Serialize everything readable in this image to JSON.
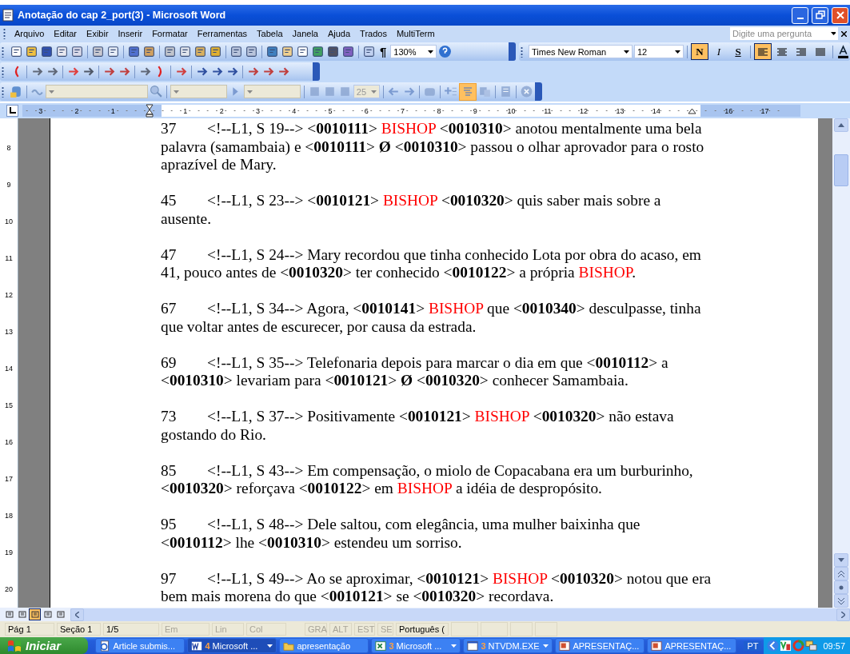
{
  "window": {
    "title": "Anotação do cap 2_port(3) - Microsoft Word"
  },
  "menu": [
    "Arquivo",
    "Editar",
    "Exibir",
    "Inserir",
    "Formatar",
    "Ferramentas",
    "Tabela",
    "Janela",
    "Ajuda",
    "Trados",
    "MultiTerm"
  ],
  "help_box": {
    "placeholder": "Digite uma pergunta"
  },
  "standard_toolbar": {
    "pilcrow": "¶",
    "zoom": "130%"
  },
  "formatting_toolbar": {
    "font": "Times New Roman",
    "size": "12",
    "styles": [
      {
        "label": "N",
        "kind": "bold",
        "selected": true
      },
      {
        "label": "I",
        "kind": "italic",
        "selected": false
      },
      {
        "label": "S",
        "kind": "underline",
        "selected": false
      }
    ],
    "alignments": [
      {
        "kind": "left",
        "selected": true
      },
      {
        "kind": "center",
        "selected": false
      },
      {
        "kind": "right",
        "selected": false
      },
      {
        "kind": "justify",
        "selected": false
      }
    ]
  },
  "trados_toolbar": {
    "number_field": "25",
    "view_on": true
  },
  "ruler": {
    "left_numbers": [
      "3",
      "2",
      "1"
    ],
    "numbers": [
      "1",
      "2",
      "3",
      "4",
      "5",
      "6",
      "7",
      "8",
      "9",
      "10",
      "11",
      "12",
      "13",
      "14"
    ],
    "right_numbers": [
      "16",
      "17"
    ]
  },
  "vertical_ruler": [
    "8",
    "9",
    "10",
    "11",
    "12",
    "13",
    "14",
    "15",
    "16",
    "17",
    "18",
    "19",
    "20"
  ],
  "paragraphs": [
    {
      "number": "37",
      "runs": [
        {
          "kind": "text",
          "text": "<!--L1, S 19--> <**0010111**> "
        },
        {
          "kind": "highlight",
          "text": "BISHOP"
        },
        {
          "kind": "text",
          "text": " <**0010310**> anotou mentalmente uma bela palavra (samambaia) e <**0010111**> **Ø** <**0010310**> passou o olhar aprovador para o rosto aprazível de Mary."
        }
      ]
    },
    {
      "number": "45",
      "runs": [
        {
          "kind": "text",
          "text": "<!--L1, S 23--> <**0010121**> "
        },
        {
          "kind": "highlight",
          "text": "BISHOP"
        },
        {
          "kind": "text",
          "text": " <**0010320**> quis saber mais sobre a ausente."
        }
      ]
    },
    {
      "number": "47",
      "runs": [
        {
          "kind": "text",
          "text": "<!--L1, S 24--> Mary recordou que tinha conhecido Lota por obra do acaso, em 41, pouco antes de <**0010320**> ter conhecido <**0010122**> a própria "
        },
        {
          "kind": "highlight",
          "text": "BISHOP"
        },
        {
          "kind": "text",
          "text": "."
        }
      ]
    },
    {
      "number": "67",
      "runs": [
        {
          "kind": "text",
          "text": "<!--L1, S 34--> Agora, <**0010141**> "
        },
        {
          "kind": "highlight",
          "text": "BISHOP"
        },
        {
          "kind": "text",
          "text": " que <**0010340**> desculpasse, tinha que voltar antes de escurecer, por causa da estrada."
        }
      ]
    },
    {
      "number": "69",
      "runs": [
        {
          "kind": "text",
          "text": "<!--L1, S 35--> Telefonaria depois para marcar o dia em que <**0010112**> a <**0010310**> levariam para <**0010121**> **Ø** <**0010320**> conhecer Samambaia."
        }
      ]
    },
    {
      "number": "73",
      "runs": [
        {
          "kind": "text",
          "text": "<!--L1, S 37--> Positivamente <**0010121**> "
        },
        {
          "kind": "highlight",
          "text": "BISHOP"
        },
        {
          "kind": "text",
          "text": " <**0010320**> não estava gostando do Rio."
        }
      ]
    },
    {
      "number": "85",
      "runs": [
        {
          "kind": "text",
          "text": "<!--L1, S 43--> Em compensação, o miolo de Copacabana era um burburinho, <**0010320**> reforçava <**0010122**> em "
        },
        {
          "kind": "highlight",
          "text": "BISHOP"
        },
        {
          "kind": "text",
          "text": " a idéia de despropósito."
        }
      ]
    },
    {
      "number": "95",
      "runs": [
        {
          "kind": "text",
          "text": "<!--L1, S 48--> Dele saltou, com elegância, uma mulher baixinha que <**0010112**> lhe <**0010310**> estendeu um sorriso."
        }
      ]
    },
    {
      "number": "97",
      "runs": [
        {
          "kind": "text",
          "text": "<!--L1, S 49--> Ao se aproximar, <**0010121**> "
        },
        {
          "kind": "highlight",
          "text": "BISHOP"
        },
        {
          "kind": "text",
          "text": " <**0010320**> notou que era bem mais morena do que <**0010121**> se <**0010320**> recordava."
        }
      ]
    }
  ],
  "view_buttons": [
    {
      "selected": false
    },
    {
      "selected": false
    },
    {
      "selected": true
    },
    {
      "selected": false
    },
    {
      "selected": false
    }
  ],
  "status_bar": [
    {
      "text": "Pág 1",
      "disabled": false
    },
    {
      "text": "Seção 1",
      "disabled": false
    },
    {
      "text": "1/5",
      "disabled": false
    },
    {
      "text": "Em",
      "disabled": true
    },
    {
      "text": "Lin",
      "disabled": true
    },
    {
      "text": "Col",
      "disabled": true
    },
    {
      "text": "GRA",
      "disabled": true
    },
    {
      "text": "ALT",
      "disabled": true
    },
    {
      "text": "EST",
      "disabled": true
    },
    {
      "text": "SE",
      "disabled": true
    },
    {
      "text": "Português (",
      "disabled": false
    }
  ],
  "taskbar": {
    "start": "Iniciar",
    "tasks": [
      {
        "label": "Article submis...",
        "kind": "browser",
        "selected": false,
        "grouped": false
      },
      {
        "count": "4",
        "label": "Microsoft ...",
        "kind": "word",
        "selected": true,
        "grouped": true
      },
      {
        "label": "apresentação",
        "kind": "folder",
        "selected": false,
        "grouped": false
      },
      {
        "count": "3",
        "label": "Microsoft ...",
        "kind": "excel",
        "selected": false,
        "grouped": true
      },
      {
        "count": "3",
        "label": "NTVDM.EXE",
        "kind": "window",
        "selected": false,
        "grouped": true
      },
      {
        "label": "APRESENTAÇ...",
        "kind": "slides",
        "selected": false,
        "grouped": false
      },
      {
        "label": "APRESENTAÇ...",
        "kind": "slides",
        "selected": false,
        "grouped": false
      }
    ],
    "language": "PT",
    "time": "09:57"
  }
}
